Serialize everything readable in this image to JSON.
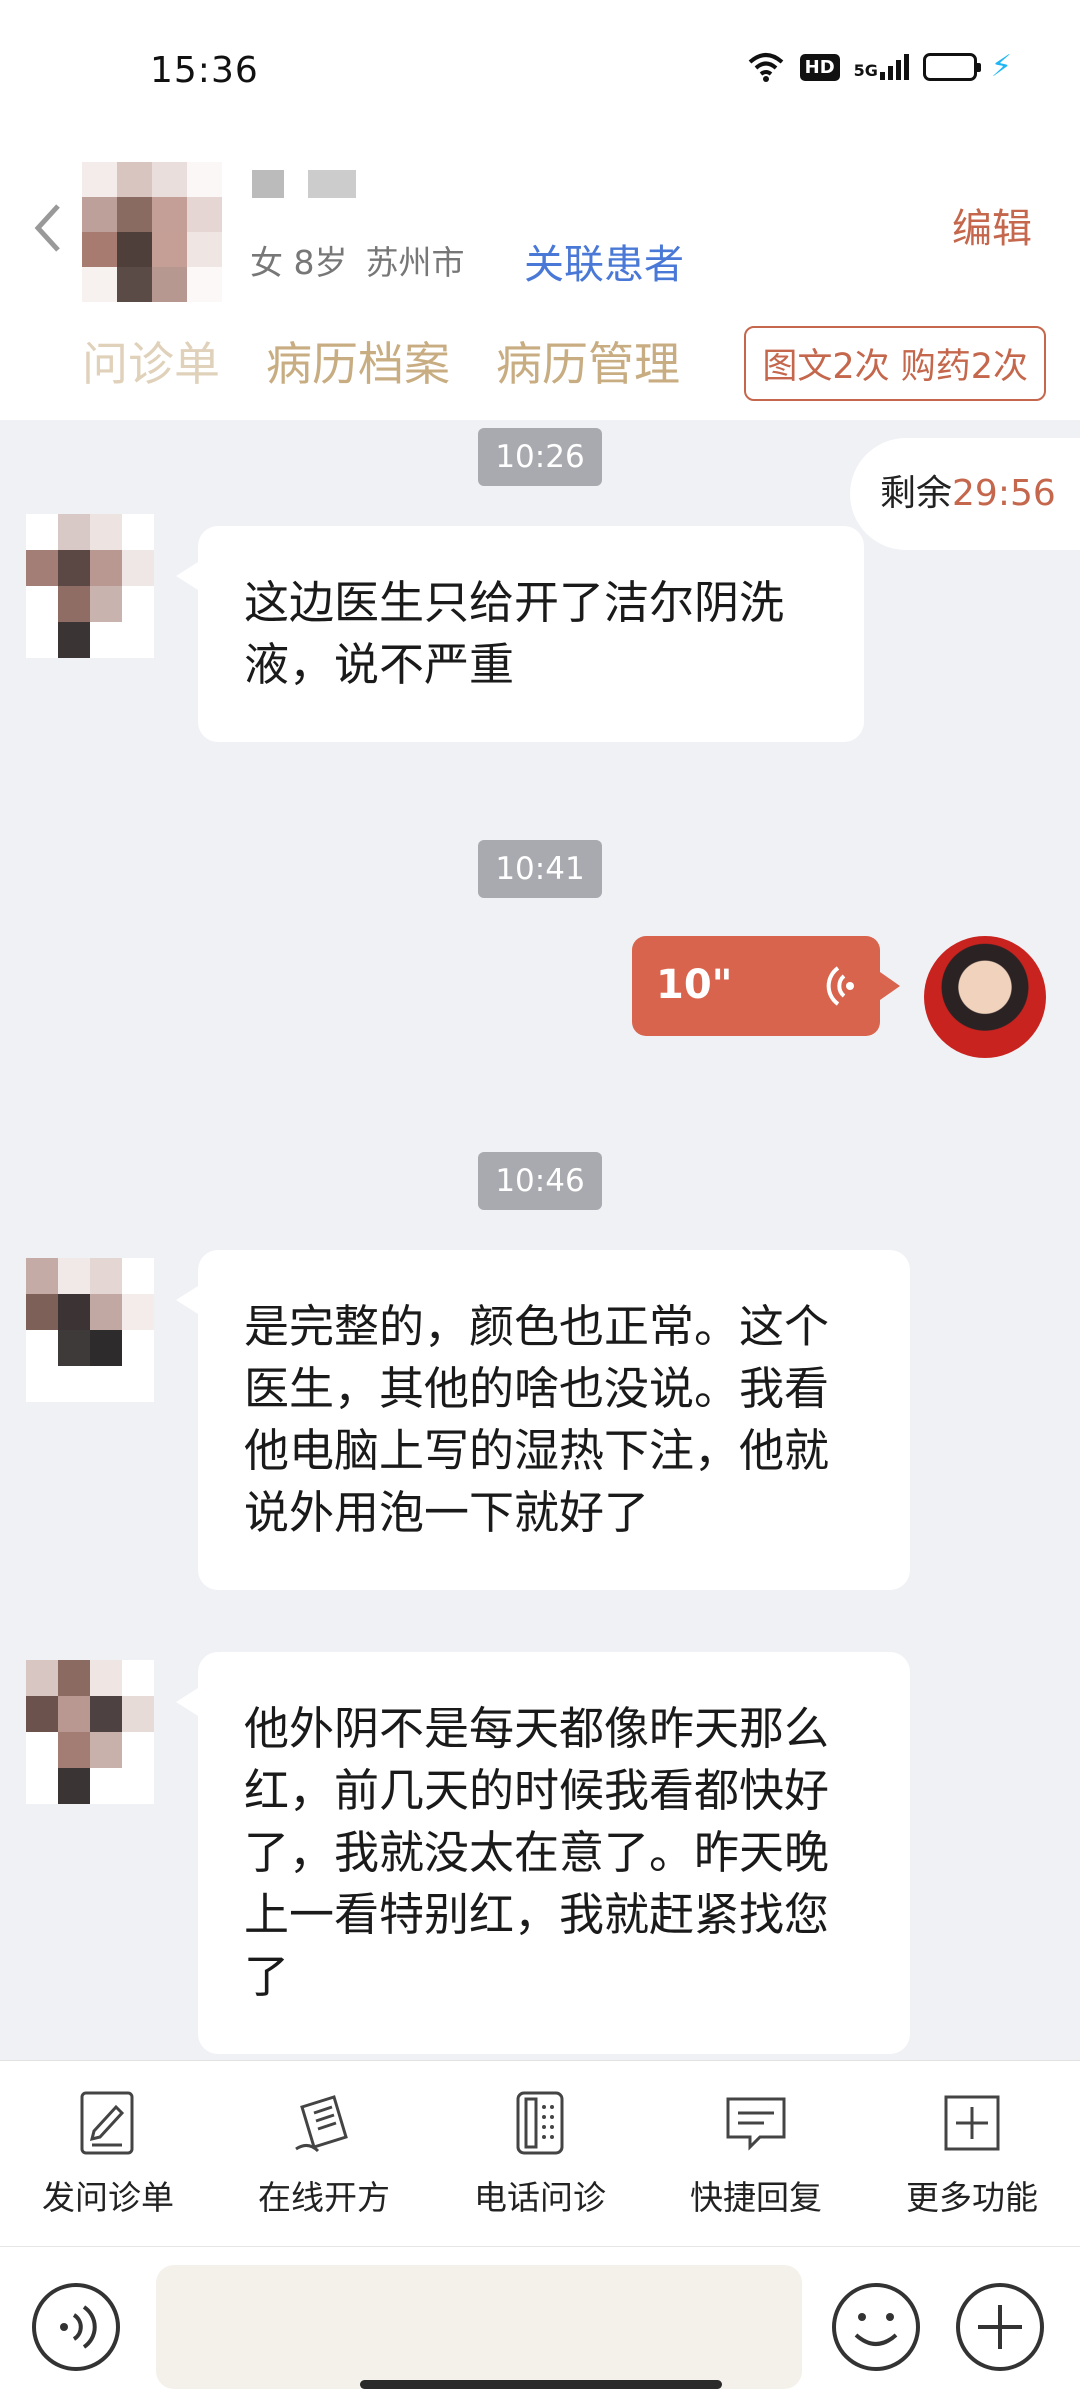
{
  "status_bar": {
    "time": "15:36",
    "network": "5G"
  },
  "header": {
    "patient_gender_age": "女 8岁",
    "patient_city": "苏州市",
    "link_label": "关联患者",
    "edit_label": "编辑",
    "tabs": [
      "问诊单",
      "病历档案",
      "病历管理"
    ],
    "quota_label": "图文2次 购药2次"
  },
  "chat": {
    "remaining_label": "剩余",
    "remaining_time": "29:56",
    "timestamps": [
      "10:26",
      "10:41",
      "10:46"
    ],
    "messages": [
      "这边医生只给开了洁尔阴洗液，说不严重",
      "是完整的，颜色也正常。这个医生，其他的啥也没说。我看他电脑上写的湿热下注，他就说外用泡一下就好了",
      "他外阴不是每天都像昨天那么红，前几天的时候我看都快好了，我就没太在意了。昨天晚上一看特别红，我就赶紧找您了"
    ],
    "voice_duration": "10\""
  },
  "toolbar": {
    "items": [
      {
        "label": "发问诊单",
        "icon": "form-edit-icon"
      },
      {
        "label": "在线开方",
        "icon": "prescription-icon"
      },
      {
        "label": "电话问诊",
        "icon": "phone-icon"
      },
      {
        "label": "快捷回复",
        "icon": "quick-reply-icon"
      },
      {
        "label": "更多功能",
        "icon": "more-plus-icon"
      }
    ]
  },
  "input": {
    "placeholder": ""
  },
  "colors": {
    "accent": "#c4674c",
    "link": "#4a78d6",
    "tab": "#c8ad82",
    "voice_bubble": "#d9644d",
    "timestamp_bg": "#a9aaaf"
  }
}
